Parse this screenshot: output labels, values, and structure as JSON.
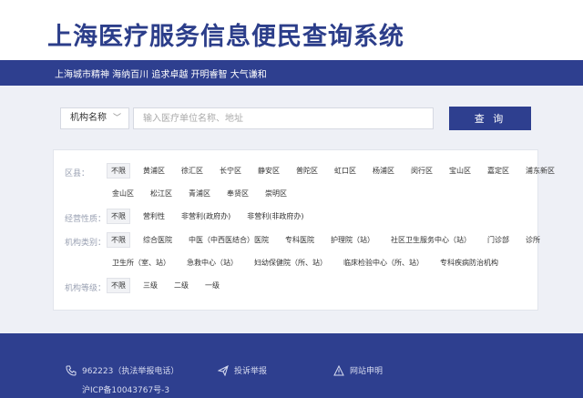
{
  "header": {
    "title": "上海医疗服务信息便民查询系统"
  },
  "slogan": "上海城市精神 海纳百川 追求卓越 开明睿智 大气谦和",
  "search": {
    "type_selected": "机构名称",
    "placeholder": "输入医疗单位名称、地址",
    "button_label": "查 询"
  },
  "filters": {
    "district": {
      "label": "区县：",
      "options_row1": [
        "不限",
        "黄浦区",
        "徐汇区",
        "长宁区",
        "静安区",
        "普陀区",
        "虹口区",
        "杨浦区",
        "闵行区",
        "宝山区",
        "嘉定区",
        "浦东新区"
      ],
      "options_row2": [
        "金山区",
        "松江区",
        "青浦区",
        "奉贤区",
        "崇明区"
      ]
    },
    "nature": {
      "label": "经营性质：",
      "options": [
        "不限",
        "营利性",
        "非营利(政府办)",
        "非营利(非政府办)"
      ]
    },
    "category": {
      "label": "机构类别：",
      "options_row1": [
        "不限",
        "综合医院",
        "中医（中西医结合）医院",
        "专科医院",
        "护理院（站）",
        "社区卫生服务中心（站）",
        "门诊部",
        "诊所"
      ],
      "options_row2": [
        "卫生所（室、站）",
        "急救中心（站）",
        "妇幼保健院（所、站）",
        "临床检验中心（所、站）",
        "专科疾病防治机构"
      ]
    },
    "level": {
      "label": "机构等级：",
      "options": [
        "不限",
        "三级",
        "二级",
        "一级"
      ]
    }
  },
  "footer": {
    "hotline": "962223（执法举报电话）",
    "complaint": "投诉举报",
    "disclaimer": "网站申明",
    "icp": "沪ICP备10043767号-3"
  },
  "colors": {
    "brand": "#2e3f8f",
    "title": "#2c3e8a",
    "background": "#eef0f6"
  }
}
